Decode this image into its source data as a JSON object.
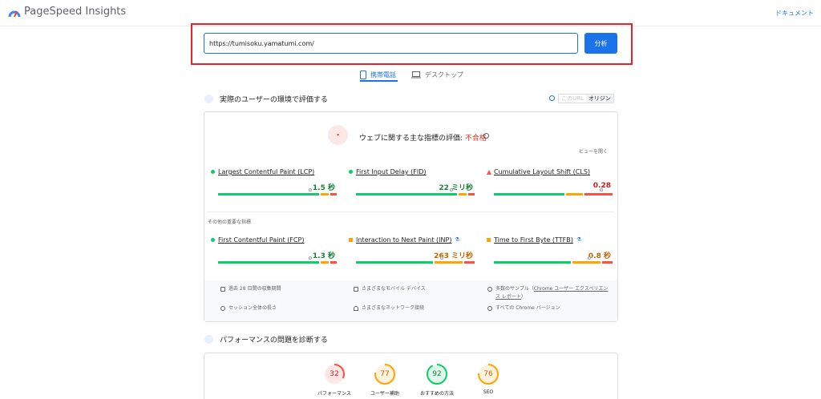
{
  "header": {
    "app_title": "PageSpeed Insights",
    "docs_link": "ドキュメント"
  },
  "search": {
    "url_value": "https://tumisoku.yamatumi.com/",
    "analyze_label": "分析"
  },
  "tabs": [
    {
      "label": "携帯電話",
      "icon": "phone-icon",
      "active": true
    },
    {
      "label": "デスクトップ",
      "icon": "laptop-icon",
      "active": false
    }
  ],
  "field": {
    "title": "実際のユーザーの環境で評価する",
    "toggle": {
      "this_url": "このURL",
      "origin": "オリジン"
    },
    "assessment_prefix": "ウェブに関する主な指標の評価: ",
    "assessment_result": "不合格",
    "expand_label": "ビューを開く",
    "core_metrics": [
      {
        "name": "Largest Contentful Paint (LCP)",
        "value": "1.5 秒",
        "status": "good",
        "marker": 0.75
      },
      {
        "name": "First Input Delay (FID)",
        "value": "22 ミリ秒",
        "status": "good",
        "marker": 0.78
      },
      {
        "name": "Cumulative Layout Shift (CLS)",
        "value": "0.28",
        "status": "poor",
        "marker": 0.88
      }
    ],
    "other_label": "その他の重要な指標",
    "other_metrics": [
      {
        "name": "First Contentful Paint (FCP)",
        "value": "1.3 秒",
        "status": "good",
        "marker": 0.75
      },
      {
        "name": "Interaction to Next Paint (INP)",
        "value": "263 ミリ秒",
        "status": "average",
        "marker": 0.7,
        "experimental": true
      },
      {
        "name": "Time to First Byte (TTFB)",
        "value": "0.8 秒",
        "status": "average",
        "marker": 0.78,
        "experimental": true
      }
    ],
    "footer": [
      {
        "icon": "calendar-icon",
        "text": "過去 28 日間の収集期間"
      },
      {
        "icon": "devices-icon",
        "text": "さまざまなモバイル デバイス"
      },
      {
        "icon": "people-icon",
        "text_prefix": "多数のサンプル（",
        "link": "Chrome ユーザー エクスペリエンス レポート",
        "text_suffix": "）"
      },
      {
        "icon": "timer-icon",
        "text": "セッション全体の長さ"
      },
      {
        "icon": "wifi-icon",
        "text": "さまざまなネットワーク接続"
      },
      {
        "icon": "chrome-icon",
        "text": "すべての Chrome バージョン"
      }
    ]
  },
  "lab": {
    "title": "パフォーマンスの問題を診断する",
    "scores": [
      {
        "label": "パフォーマンス",
        "value": 32,
        "color": "#ff4e42"
      },
      {
        "label": "ユーザー補助",
        "value": 77,
        "color": "#ffa400"
      },
      {
        "label": "おすすめの方法",
        "value": 92,
        "color": "#0cce6b"
      },
      {
        "label": "SEO",
        "value": 76,
        "color": "#ffa400"
      }
    ]
  },
  "colors": {
    "accent": "#1a73e8",
    "good": "#0cce6b",
    "average": "#ffa400",
    "poor": "#ff4e42",
    "highlight_border": "#e8232c"
  }
}
